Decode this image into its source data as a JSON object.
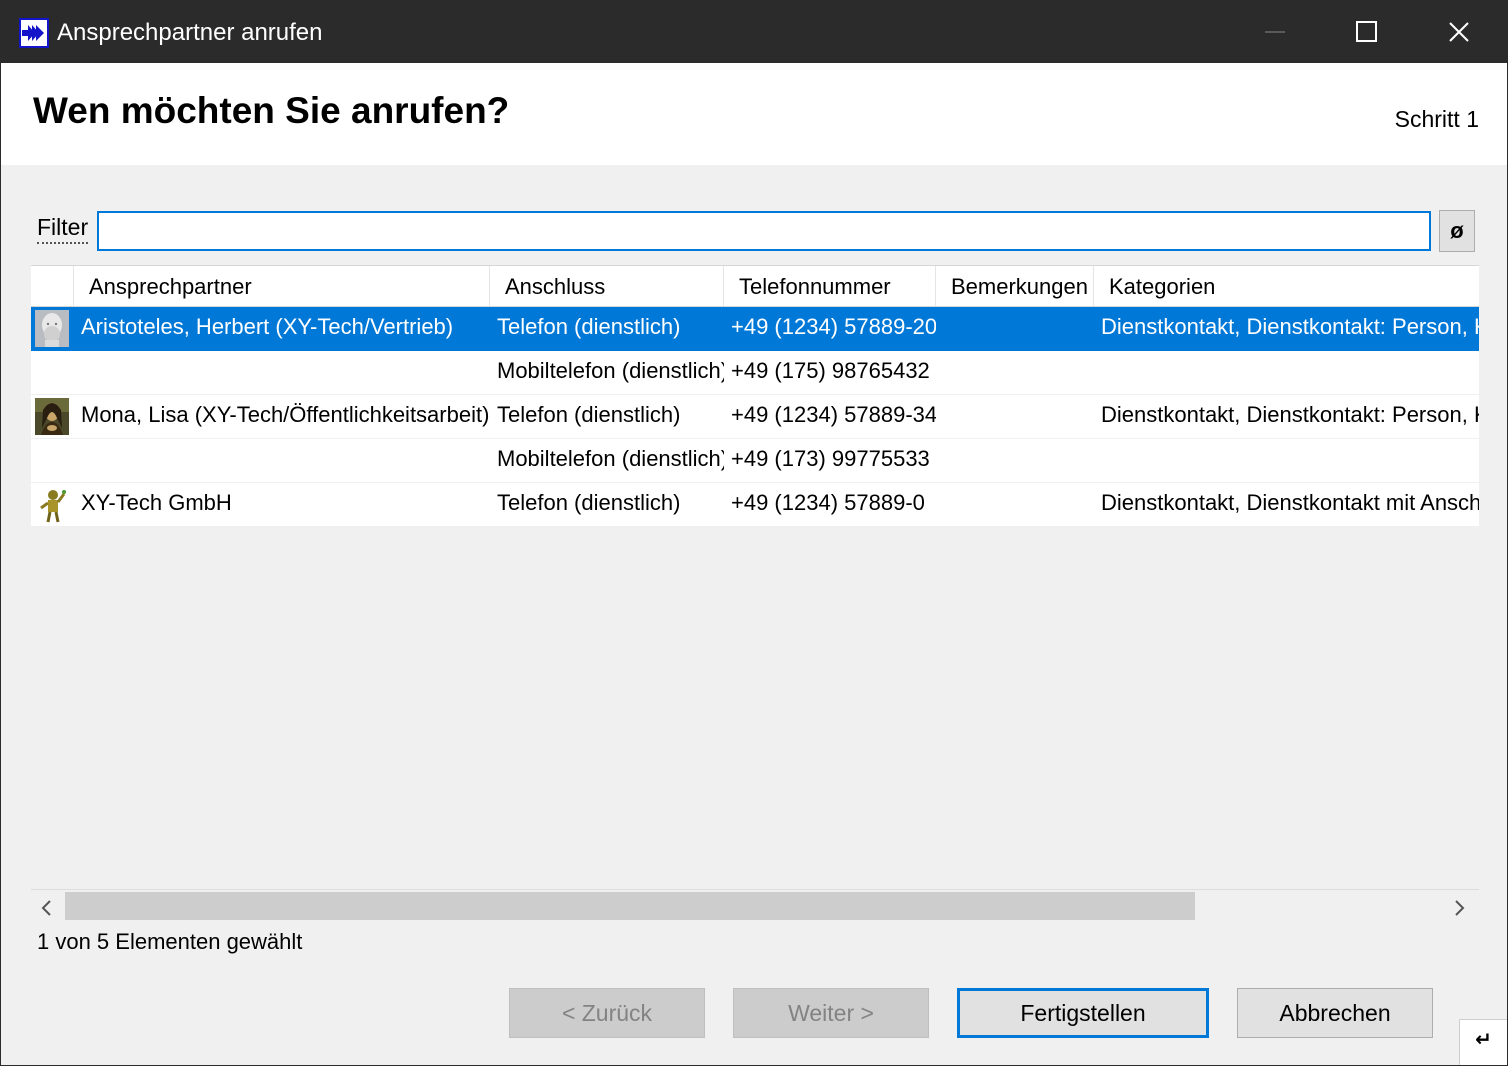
{
  "window": {
    "title": "Ansprechpartner anrufen",
    "icon": "double-arrow-right-icon"
  },
  "header": {
    "title": "Wen möchten Sie anrufen?",
    "step": "Schritt 1"
  },
  "filter": {
    "label": "Filter",
    "value": "",
    "clear_label": "ø"
  },
  "columns": [
    {
      "key": "icon",
      "label": ""
    },
    {
      "key": "contact",
      "label": "Ansprechpartner"
    },
    {
      "key": "connection",
      "label": "Anschluss"
    },
    {
      "key": "phone",
      "label": "Telefonnummer"
    },
    {
      "key": "remarks",
      "label": "Bemerkungen"
    },
    {
      "key": "categories",
      "label": "Kategorien"
    }
  ],
  "rows": [
    {
      "avatar": "bust-portrait-icon",
      "contact": "Aristoteles, Herbert (XY-Tech/Vertrieb)",
      "connection": "Telefon (dienstlich)",
      "phone": "+49 (1234) 57889-20",
      "remarks": "",
      "categories": "Dienstkontakt, Dienstkontakt: Person, K",
      "selected": true
    },
    {
      "avatar": "",
      "contact": "",
      "connection": "Mobiltelefon (dienstlich)",
      "phone": "+49 (175) 98765432",
      "remarks": "",
      "categories": "",
      "selected": false
    },
    {
      "avatar": "mona-lisa-portrait-icon",
      "contact": "Mona, Lisa (XY-Tech/Öffentlichkeitsarbeit)",
      "connection": "Telefon (dienstlich)",
      "phone": "+49 (1234) 57889-34",
      "remarks": "",
      "categories": "Dienstkontakt, Dienstkontakt: Person, K",
      "selected": false
    },
    {
      "avatar": "",
      "contact": "",
      "connection": "Mobiltelefon (dienstlich)",
      "phone": "+49 (173) 99775533",
      "remarks": "",
      "categories": "",
      "selected": false
    },
    {
      "avatar": "company-figure-icon",
      "contact": "XY-Tech GmbH",
      "connection": "Telefon (dienstlich)",
      "phone": "+49 (1234) 57889-0",
      "remarks": "",
      "categories": "Dienstkontakt, Dienstkontakt mit Anschr",
      "selected": false
    }
  ],
  "status": "1 von 5 Elementen gewählt",
  "buttons": {
    "back": "< Zurück",
    "next": "Weiter >",
    "finish": "Fertigstellen",
    "cancel": "Abbrechen"
  },
  "colors": {
    "titlebar": "#2b2b2b",
    "selection": "#0078d7",
    "accent": "#0078d7"
  }
}
